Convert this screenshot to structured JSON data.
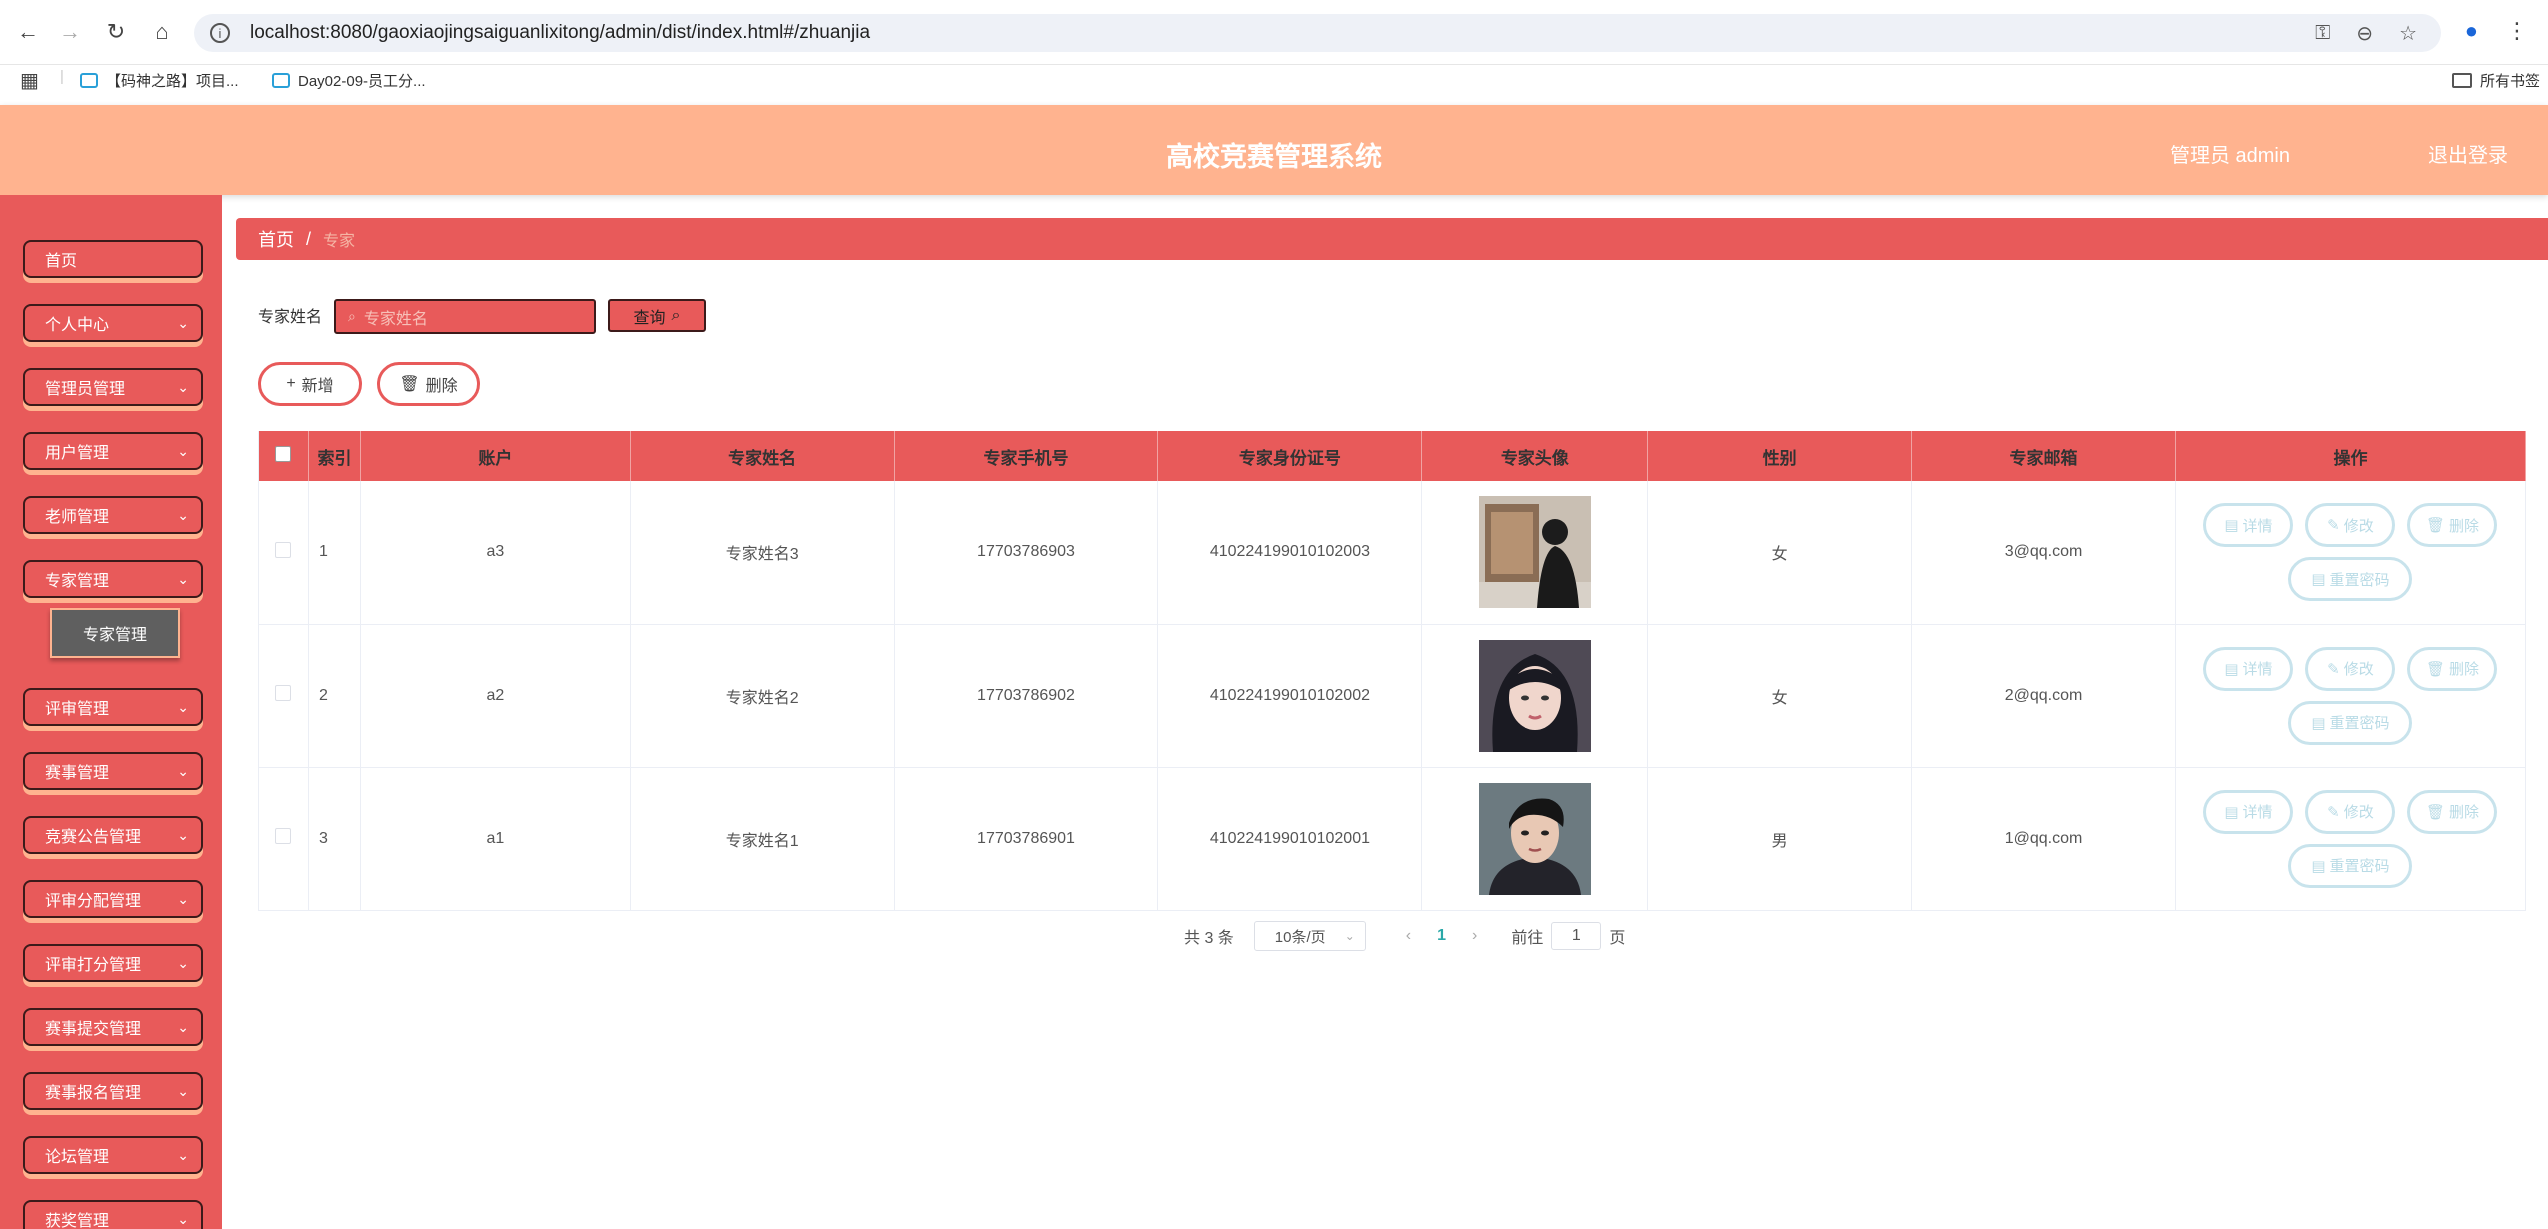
{
  "browser": {
    "url": "localhost:8080/gaoxiaojingsaiguanlixitong/admin/dist/index.html#/zhuanjia",
    "bookmarks": [
      "【码神之路】项目...",
      "Day02-09-员工分..."
    ],
    "all_bookmarks": "所有书签"
  },
  "header": {
    "title": "高校竞赛管理系统",
    "admin_label": "管理员 admin",
    "logout": "退出登录"
  },
  "sidebar": {
    "items": [
      {
        "label": "首页",
        "has_chevron": false
      },
      {
        "label": "个人中心",
        "has_chevron": true
      },
      {
        "label": "管理员管理",
        "has_chevron": true
      },
      {
        "label": "用户管理",
        "has_chevron": true
      },
      {
        "label": "老师管理",
        "has_chevron": true
      },
      {
        "label": "专家管理",
        "has_chevron": true
      },
      {
        "label": "评审管理",
        "has_chevron": true
      },
      {
        "label": "赛事管理",
        "has_chevron": true
      },
      {
        "label": "竞赛公告管理",
        "has_chevron": true
      },
      {
        "label": "评审分配管理",
        "has_chevron": true
      },
      {
        "label": "评审打分管理",
        "has_chevron": true
      },
      {
        "label": "赛事提交管理",
        "has_chevron": true
      },
      {
        "label": "赛事报名管理",
        "has_chevron": true
      },
      {
        "label": "论坛管理",
        "has_chevron": true
      },
      {
        "label": "获奖管理",
        "has_chevron": true
      }
    ],
    "submenu": "专家管理"
  },
  "breadcrumb": {
    "home": "首页",
    "sep": "/",
    "current": "专家"
  },
  "search": {
    "label": "专家姓名",
    "placeholder": "专家姓名",
    "button": "查询"
  },
  "actions": {
    "add": "新增",
    "delete": "删除"
  },
  "table": {
    "columns": [
      "索引",
      "账户",
      "专家姓名",
      "专家手机号",
      "专家身份证号",
      "专家头像",
      "性别",
      "专家邮箱",
      "操作"
    ],
    "rows": [
      {
        "index": "1",
        "account": "a3",
        "name": "专家姓名3",
        "phone": "17703786903",
        "id_card": "410224199010102003",
        "gender": "女",
        "email": "3@qq.com"
      },
      {
        "index": "2",
        "account": "a2",
        "name": "专家姓名2",
        "phone": "17703786902",
        "id_card": "410224199010102002",
        "gender": "女",
        "email": "2@qq.com"
      },
      {
        "index": "3",
        "account": "a1",
        "name": "专家姓名1",
        "phone": "17703786901",
        "id_card": "410224199010102001",
        "gender": "男",
        "email": "1@qq.com"
      }
    ],
    "ops": {
      "detail": "详情",
      "edit": "修改",
      "delete": "删除",
      "reset": "重置密码"
    }
  },
  "pagination": {
    "total": "共 3 条",
    "page_size": "10条/页",
    "current": "1",
    "goto": "前往",
    "page_input": "1",
    "page_unit": "页"
  },
  "colors": {
    "accent": "#e85a5a",
    "header": "#ffb38f",
    "op_btn": "#c8e3ec"
  }
}
